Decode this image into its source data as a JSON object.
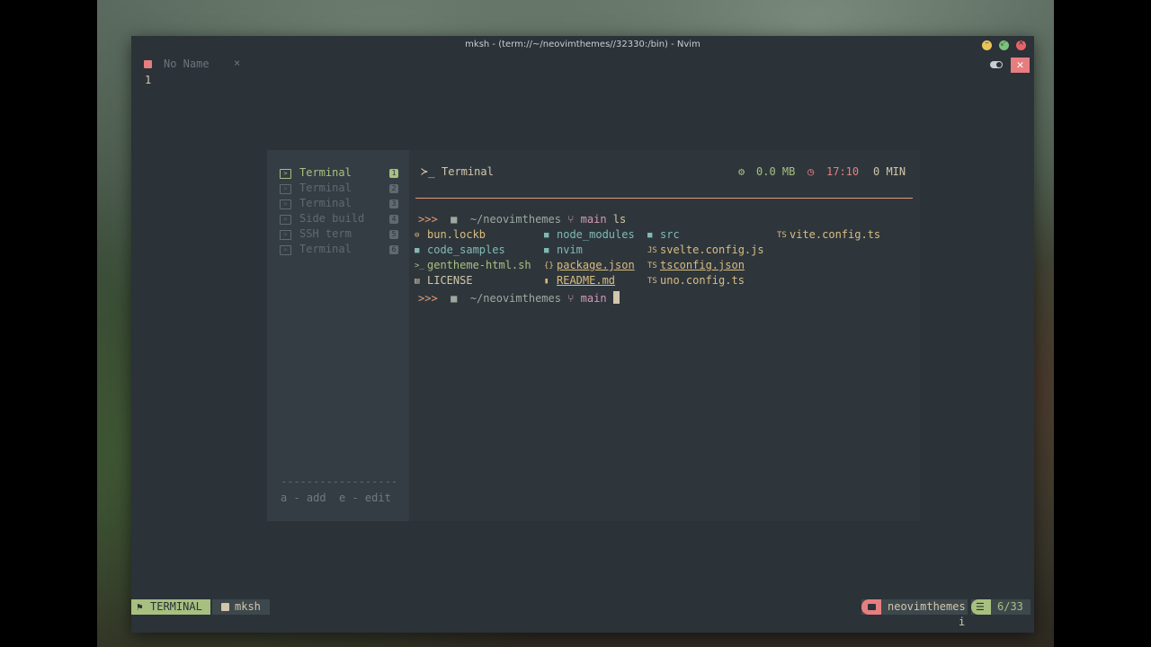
{
  "window": {
    "title": "mksh - (term://~/neovimthemes//32330:/bin) - Nvim",
    "controls": [
      "minimize",
      "maximize",
      "close"
    ]
  },
  "tabline": {
    "buffer_name": "No Name",
    "close_glyph": "×",
    "right_close_glyph": "✕"
  },
  "editor": {
    "line_number": "1"
  },
  "terminal_manager": {
    "terminals": [
      {
        "label": "Terminal",
        "index": "1",
        "active": true
      },
      {
        "label": "Terminal",
        "index": "2",
        "active": false
      },
      {
        "label": "Terminal",
        "index": "3",
        "active": false
      },
      {
        "label": "Side build",
        "index": "4",
        "active": false
      },
      {
        "label": "SSH term",
        "index": "5",
        "active": false
      },
      {
        "label": "Terminal",
        "index": "6",
        "active": false
      }
    ],
    "separator": "------------------",
    "help": "a - add  e - edit",
    "header": {
      "prompt_icon": "≻_",
      "title": "Terminal",
      "memory": "0.0 MB",
      "time": "17:10",
      "minutes": "0 MIN"
    },
    "prompt": {
      "arrows": ">>>",
      "folder_icon": "■",
      "dir": "~/neovimthemes",
      "branch_icon": "⑂",
      "branch": "main"
    },
    "command": "ls",
    "ls_output": [
      [
        {
          "name": "bun.lockb",
          "icon": "⊖",
          "color": "yellow"
        },
        {
          "name": "code_samples",
          "icon": "■",
          "color": "blue"
        },
        {
          "name": "gentheme-html.sh",
          "icon": ">_",
          "color": "green"
        },
        {
          "name": "LICENSE",
          "icon": "▤",
          "color": "plain"
        }
      ],
      [
        {
          "name": "node_modules",
          "icon": "■",
          "color": "blue"
        },
        {
          "name": "nvim",
          "icon": "■",
          "color": "blue"
        },
        {
          "name": "package.json",
          "icon": "{}",
          "color": "yellow",
          "underline": true
        },
        {
          "name": "README.md",
          "icon": "▮",
          "color": "yellow",
          "underline": true
        }
      ],
      [
        {
          "name": "src",
          "icon": "■",
          "color": "blue"
        },
        {
          "name": "svelte.config.js",
          "icon": "JS",
          "color": "yellow"
        },
        {
          "name": "tsconfig.json",
          "icon": "TS",
          "color": "yellow",
          "underline": true
        },
        {
          "name": "uno.config.ts",
          "icon": "TS",
          "color": "yellow"
        }
      ],
      [
        {
          "name": "vite.config.ts",
          "icon": "TS",
          "color": "yellow"
        }
      ]
    ]
  },
  "statusline": {
    "mode": "TERMINAL",
    "file": "mksh",
    "project": "neovimthemes",
    "position": "6/33",
    "cmdline_char": "i"
  },
  "colors": {
    "bg": "#2b3238",
    "green": "#a7c080",
    "red": "#e67e80",
    "orange": "#e69875",
    "yellow": "#dbbc7f",
    "blue": "#7fbbb3",
    "fg": "#d3c6aa"
  }
}
